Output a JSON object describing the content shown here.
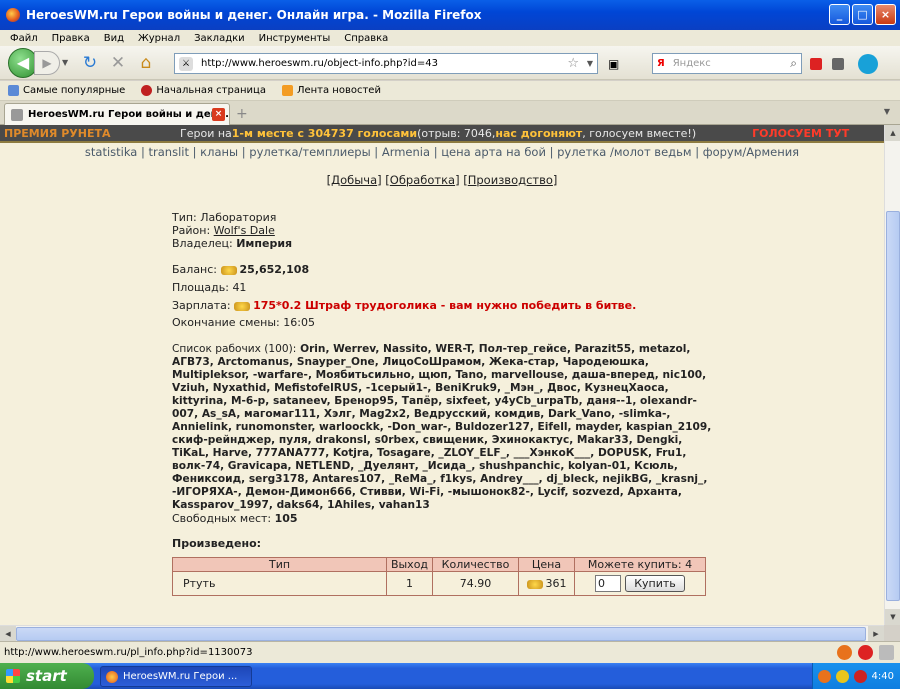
{
  "window": {
    "title": "HeroesWM.ru Герои войны и денег. Онлайн игра. - Mozilla Firefox"
  },
  "menu": [
    "Файл",
    "Правка",
    "Вид",
    "Журнал",
    "Закладки",
    "Инструменты",
    "Справка"
  ],
  "nav": {
    "url": "http://www.heroeswm.ru/object-info.php?id=43",
    "search_placeholder": "Яндекс",
    "search_engine": "Я"
  },
  "bookmarks": [
    "Самые популярные",
    "Начальная страница",
    "Лента новостей"
  ],
  "tab": {
    "title": "HeroesWM.ru Герои войны и ден...",
    "close": "×",
    "new": "+"
  },
  "banner": {
    "premium": "ПРЕМИЯ РУНЕТА",
    "t1": "Герои на ",
    "t2": "1-м месте с 304737 голосами",
    "t3": " (отрыв: 7046, ",
    "t4": "нас догоняют",
    "t5": ", голосуем вместе!)",
    "vote": "ГОЛОСУЕМ ТУТ"
  },
  "links": "statistika | translit | кланы | рулетка/темплиеры | Armenia | цена арта на бой | рулетка /молот ведьм | форум/Армения",
  "sublinks": {
    "mining": "Добыча",
    "processing": "Обработка",
    "production": "Производство"
  },
  "object": {
    "type_label": "Тип:",
    "type": "Лаборатория",
    "district_label": "Район:",
    "district": "Wolf's Dale",
    "owner_label": "Владелец:",
    "owner": "Империя",
    "balance_label": "Баланс:",
    "balance": "25,652,108",
    "area_label": "Площадь:",
    "area": "41",
    "salary_label": "Зарплата:",
    "salary": "175*0.2 Штраф трудоголика - вам нужно победить в битве.",
    "shift_end_label": "Окончание смены:",
    "shift_end": "16:05"
  },
  "workers": {
    "header": "Список рабочих (100):",
    "list": "Orin, Werrev, Nassito, WER-T, Пол-тер_гейсе, Parazit55, metazol, АГВ73, Arctomanus, Snayper_One, ЛицоСоШрамом, Жека-стар, Чародеюшка, Multipleksor, -warfare-, Моябитьсильно, щюп, Tano, marvellouse, даша-вперед, nic100, Vziuh, Nyxathid, MefistofelRUS, -1серый1-, BeniKruk9, _Мэн_, Двос, КузнецХаоса, kittyrina, М-6-р, sataneev, Бренор95, Тапёр, sixfeet, y4yCb_urpaTb, даня--1, olexandr-007, As_sA, магомаг111, Хэлг, Mag2x2, Ведрусский, комдив, Dark_Vano, -slimka-, Annielink, runomonster, warloockk, -Don_war-, Buldozer127, Eifell, mayder, kaspian_2109, скиф-рейнджер, пуля, drakonsl, s0rbex, свищеник, Эхинокактус, Makar33, Dengki, TiKaL, Harve, 777ANA777, Kotjra, Tosagare, _ZLOY_ELF_, ___ХэнкоК___, DOPUSK, Fru1, волк-74, Gravicapa, NETLEND, _Дуелянт, _Исида_, shushpanchic, kolyan-01, Ксюль, Фениксоид, serg3178, Antares107, _ReMa_, f1kys, Andrey___, dj_bleck, nejikBG, _krasnj_, -ИГОРЯХА-, Демон-Димон666, Стивви, Wi-Fi, -мышонок82-, Lycif, sozvezd, Арханта, Kassparov_1997, daks64, 1Ahiles, vahan13",
    "free_label": "Свободных мест:",
    "free": "105"
  },
  "production": {
    "title": "Произведено:",
    "columns": [
      "Тип",
      "Выход",
      "Количество",
      "Цена",
      "Можете купить: 4"
    ],
    "rows": [
      {
        "type": "Ртуть",
        "output": "1",
        "quantity": "74.90",
        "price": "361",
        "qty_input": "0",
        "buy": "Купить"
      }
    ]
  },
  "status": {
    "text": "http://www.heroeswm.ru/pl_info.php?id=1130073"
  },
  "taskbar": {
    "start": "start",
    "item": "HeroesWM.ru Герои ...",
    "clock": "4:40"
  }
}
